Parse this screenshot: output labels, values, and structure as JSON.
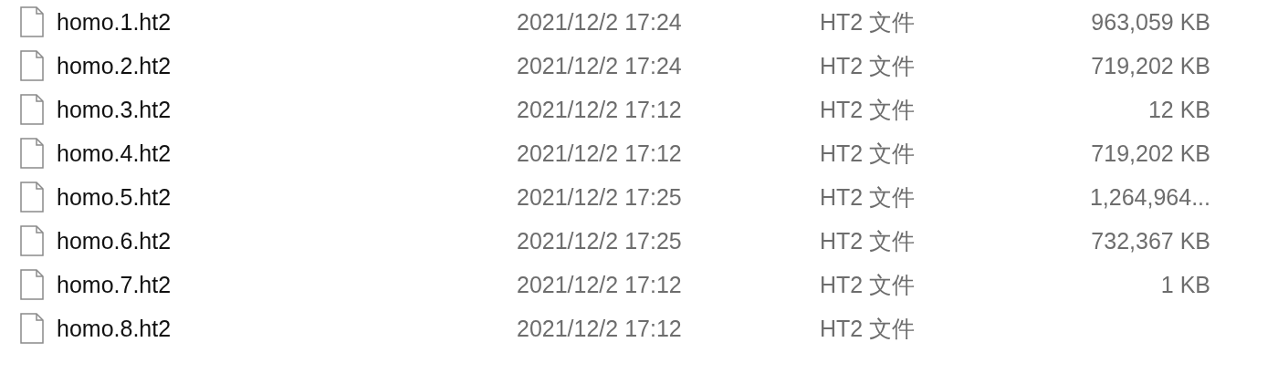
{
  "files": [
    {
      "name": "homo.1.ht2",
      "modified": "2021/12/2 17:24",
      "type": "HT2 文件",
      "size": "963,059 KB"
    },
    {
      "name": "homo.2.ht2",
      "modified": "2021/12/2 17:24",
      "type": "HT2 文件",
      "size": "719,202 KB"
    },
    {
      "name": "homo.3.ht2",
      "modified": "2021/12/2 17:12",
      "type": "HT2 文件",
      "size": "12 KB"
    },
    {
      "name": "homo.4.ht2",
      "modified": "2021/12/2 17:12",
      "type": "HT2 文件",
      "size": "719,202 KB"
    },
    {
      "name": "homo.5.ht2",
      "modified": "2021/12/2 17:25",
      "type": "HT2 文件",
      "size": "1,264,964..."
    },
    {
      "name": "homo.6.ht2",
      "modified": "2021/12/2 17:25",
      "type": "HT2 文件",
      "size": "732,367 KB"
    },
    {
      "name": "homo.7.ht2",
      "modified": "2021/12/2 17:12",
      "type": "HT2 文件",
      "size": "1 KB"
    },
    {
      "name": "homo.8.ht2",
      "modified": "2021/12/2 17:12",
      "type": "HT2 文件"
    }
  ]
}
